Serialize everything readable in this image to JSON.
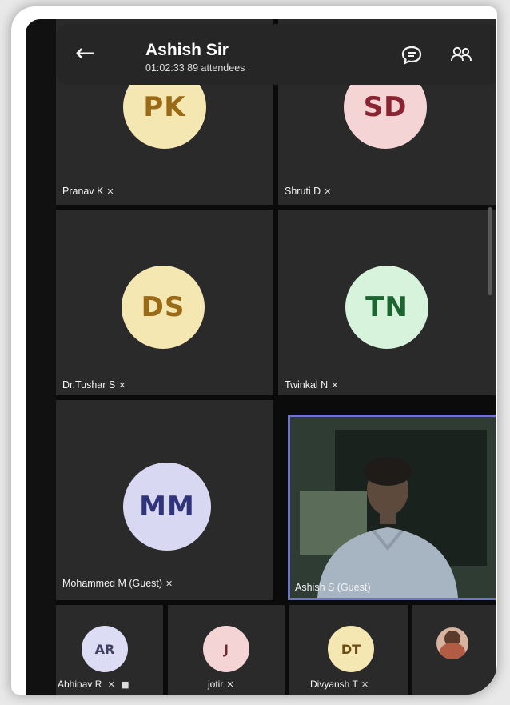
{
  "header": {
    "back_icon": "arrow-left-icon",
    "title": "Ashish Sir",
    "subtitle": "01:02:33  89 attendees",
    "chat_icon": "chat-icon",
    "people_icon": "people-icon"
  },
  "tiles": {
    "pk": {
      "initials": "PK",
      "name": "Pranav K",
      "bg": "#f4e7b1",
      "fg": "#9b6a17"
    },
    "sd": {
      "initials": "SD",
      "name": "Shruti D",
      "bg": "#f5d4d6",
      "fg": "#8a2430"
    },
    "ds": {
      "initials": "DS",
      "name": "Dr.Tushar S",
      "bg": "#f4e7b1",
      "fg": "#9b6a17"
    },
    "tn": {
      "initials": "TN",
      "name": "Twinkal N",
      "bg": "#d7f3dc",
      "fg": "#1c6430"
    },
    "mm": {
      "initials": "MM",
      "name": "Mohammed M (Guest)",
      "bg": "#d8d8f3",
      "fg": "#2f347b"
    },
    "ashish": {
      "name": "Ashish S (Guest)"
    }
  },
  "bottom": {
    "ar": {
      "initials": "AR",
      "name": "Abhinav R",
      "bg": "#dcdcf4",
      "fg": "#404060"
    },
    "j": {
      "initials": "J",
      "name": "jotir",
      "bg": "#f5d4d6",
      "fg": "#6a2a30"
    },
    "dt": {
      "initials": "DT",
      "name": "Divyansh T",
      "bg": "#f4e7b1",
      "fg": "#6b4b10"
    }
  }
}
